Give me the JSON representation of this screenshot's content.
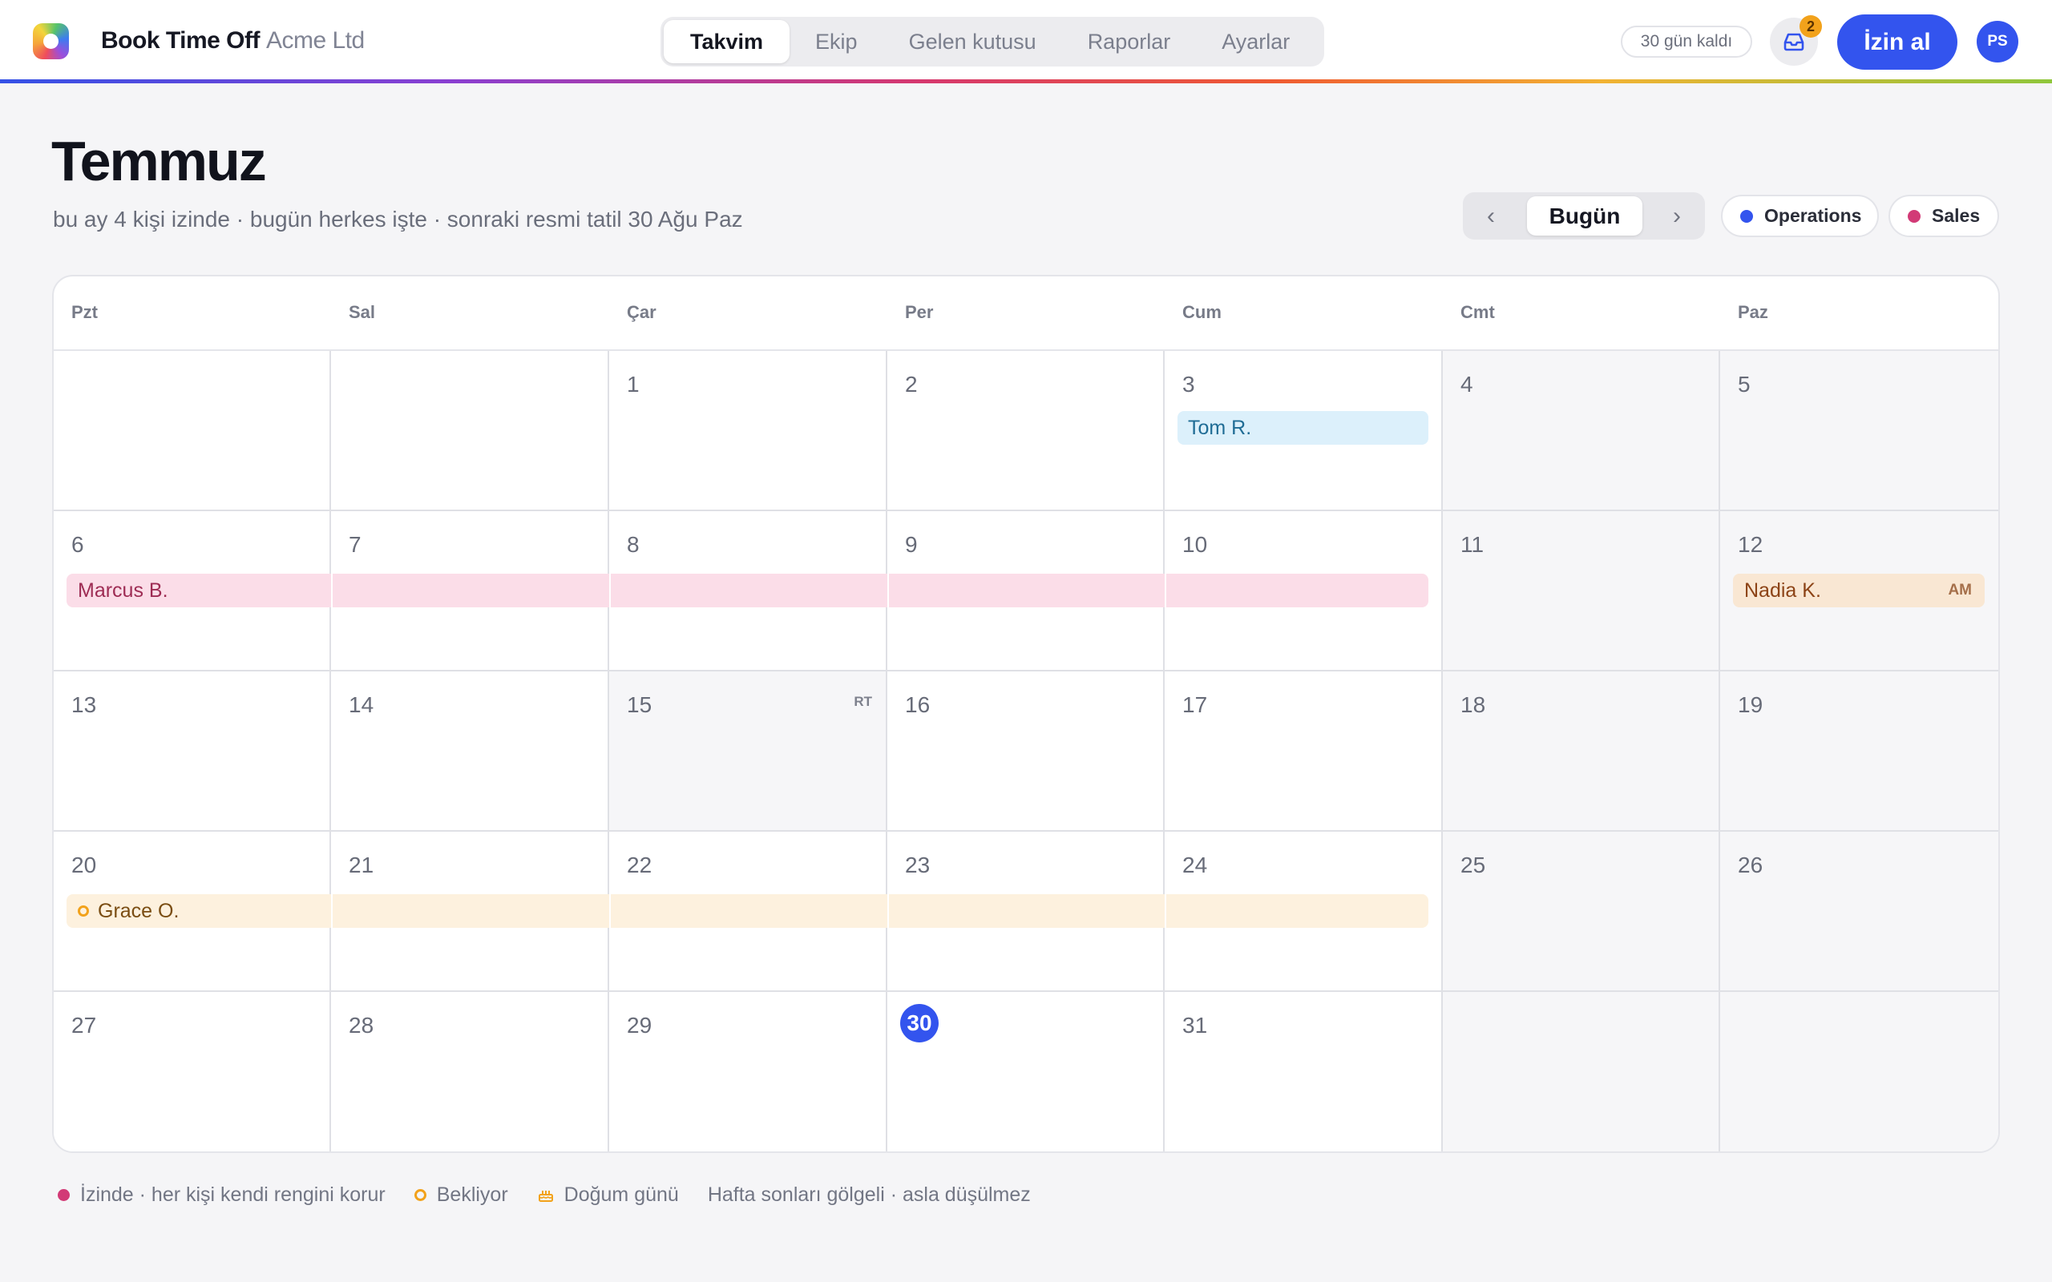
{
  "app": {
    "name": "Book Time Off",
    "org": "Acme Ltd",
    "nav": [
      "Takvim",
      "Ekip",
      "Gelen kutusu",
      "Raporlar",
      "Ayarlar"
    ],
    "active_tab": "Takvim",
    "trial": "30 gün kaldı",
    "inbox_count": "2",
    "cta": "İzin al",
    "avatar_initials": "PS",
    "accent": "#3354ee"
  },
  "header": {
    "title": "Temmuz",
    "subtitle": "bu ay 4 kişi izinde · bugün herkes işte · sonraki resmi tatil 30 Ağu Paz",
    "prev_label": "‹",
    "today_label": "Bugün",
    "next_label": "›",
    "teams": [
      {
        "name": "Operations",
        "color": "#3354ee"
      },
      {
        "name": "Sales",
        "color": "#d23a76"
      }
    ]
  },
  "calendar": {
    "weekdays": [
      "Pzt",
      "Sal",
      "Çar",
      "Per",
      "Cum",
      "Cmt",
      "Paz"
    ],
    "weeks": [
      [
        "",
        "",
        "1",
        "2",
        "3",
        "4",
        "5"
      ],
      [
        "6",
        "7",
        "8",
        "9",
        "10",
        "11",
        "12"
      ],
      [
        "13",
        "14",
        "15",
        "16",
        "17",
        "18",
        "19"
      ],
      [
        "20",
        "21",
        "22",
        "23",
        "24",
        "25",
        "26"
      ],
      [
        "27",
        "28",
        "29",
        "30",
        "31",
        "",
        ""
      ]
    ],
    "today": "30",
    "holiday": {
      "day": "15",
      "tag": "RT"
    },
    "events": [
      {
        "person": "Tom R.",
        "days": "3",
        "status": "izinde",
        "color": "#dcf0fb"
      },
      {
        "person": "Marcus B.",
        "days": "6–10",
        "status": "izinde",
        "color": "#fbdde8"
      },
      {
        "person": "Nadia K.",
        "days": "12",
        "half": "AM",
        "status": "izinde",
        "color": "#f9e7d3"
      },
      {
        "person": "Grace O.",
        "days": "20–24",
        "status": "bekliyor",
        "color": "#fdf1de"
      }
    ]
  },
  "legend": {
    "on_leave": "İzinde · her kişi kendi rengini korur",
    "pending": "Bekliyor",
    "birthday": "Doğum günü",
    "weekends": "Hafta sonları gölgeli · asla düşülmez"
  }
}
